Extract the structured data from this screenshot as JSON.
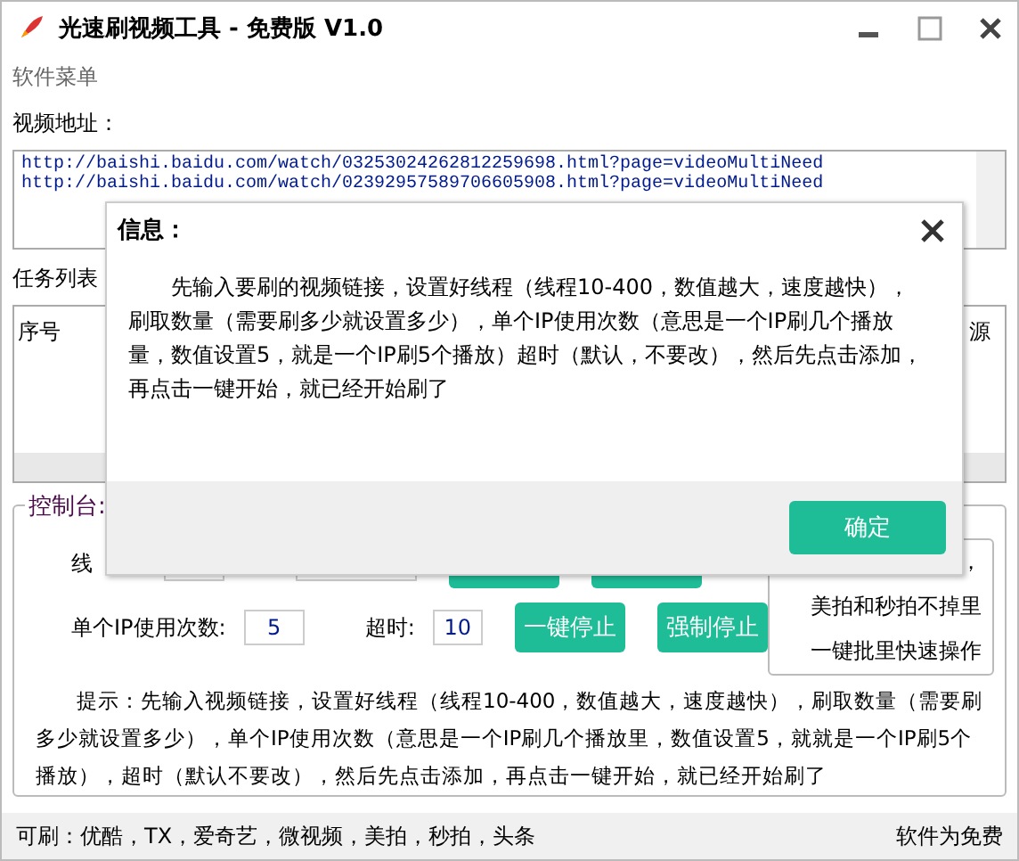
{
  "window": {
    "title": "光速刷视频工具 - 免费版 V1.0"
  },
  "menu": {
    "label": "软件菜单"
  },
  "url_section": {
    "label": "视频地址：",
    "urls": [
      "http://baishi.baidu.com/watch/03253024262812259698.html?page=videoMultiNeed",
      "http://baishi.baidu.com/watch/02392957589706605908.html?page=videoMultiNeed"
    ]
  },
  "task_list": {
    "label": "任务列表",
    "columns": [
      {
        "label": "序号"
      },
      {
        "label": "源"
      }
    ]
  },
  "console": {
    "title": "控制台:",
    "thread_label": "线",
    "ip_uses": {
      "label": "单个IP使用次数:",
      "value": "5"
    },
    "timeout": {
      "label": "超时:",
      "value": "10"
    },
    "buttons": [
      "一键停止",
      "强制停止"
    ],
    "features": [
      "，",
      "美拍和秒拍不掉里",
      "一键批里快速操作"
    ],
    "tip": "提示：先输入视频链接，设置好线程（线程10-400，数值越大，速度越快），刷取数量（需要刷多少就设置多少），单个IP使用次数（意思是一个IP刷几个播放里，数值设置5，就就是一个IP刷5个播放），超时（默认不要改），然后先点击添加，再点击一键开始，就已经开始刷了"
  },
  "status_bar": {
    "left": "可刷：优酷，TX，爱奇艺，微视频，美拍，秒拍，头条",
    "right": "软件为免费"
  },
  "dialog": {
    "title": "信息：",
    "message": "先输入要刷的视频链接，设置好线程（线程10-400，数值越大，速度越快），刷取数量（需要刷多少就设置多少），单个IP使用次数（意思是一个IP刷几个播放量，数值设置5，就是一个IP刷5个播放）超时（默认，不要改），然后先点击添加，再点击一键开始，就已经开始刷了",
    "button": "确定"
  }
}
